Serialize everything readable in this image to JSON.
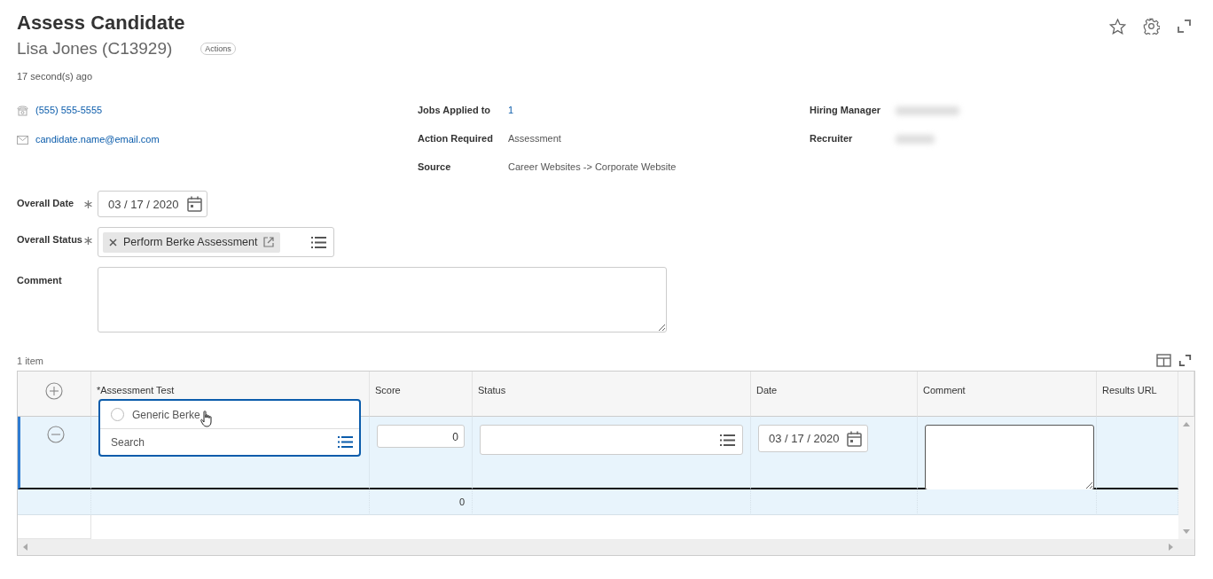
{
  "header": {
    "title": "Assess Candidate",
    "subtitle": "Lisa Jones (C13929)",
    "actions_button": "Actions",
    "updated": "17 second(s) ago"
  },
  "contact": [
    {
      "kind": "phone",
      "text": "(555) 555-5555"
    },
    {
      "kind": "email",
      "text": "candidate.name@email.com"
    }
  ],
  "details": [
    {
      "label": "Jobs Applied to",
      "value": "1",
      "kind": "link"
    },
    {
      "label": "Action Required",
      "value": "Assessment",
      "kind": "text"
    },
    {
      "label": "Source",
      "value": "Career Websites -> Corporate Website",
      "kind": "text"
    }
  ],
  "people": [
    {
      "label": "Hiring Manager"
    },
    {
      "label": "Recruiter"
    }
  ],
  "form": {
    "overall_date": {
      "label": "Overall Date",
      "required": true,
      "value": "03 / 17 / 2020"
    },
    "overall_status": {
      "label": "Overall Status",
      "required": true,
      "token": "Perform Berke Assessment"
    },
    "comment": {
      "label": "Comment"
    }
  },
  "grid": {
    "count": "1 item",
    "columns": [
      "*Assessment Test",
      "Score",
      "Status",
      "Date",
      "Comment",
      "Results URL"
    ],
    "rows": [
      {
        "selected": true,
        "score": "0",
        "date": "03 / 17 / 2020"
      }
    ],
    "total": {
      "score": "0"
    },
    "dropdown": {
      "options": [
        {
          "label": "Generic Berke",
          "selected": false
        }
      ],
      "placeholder": "Search"
    }
  }
}
